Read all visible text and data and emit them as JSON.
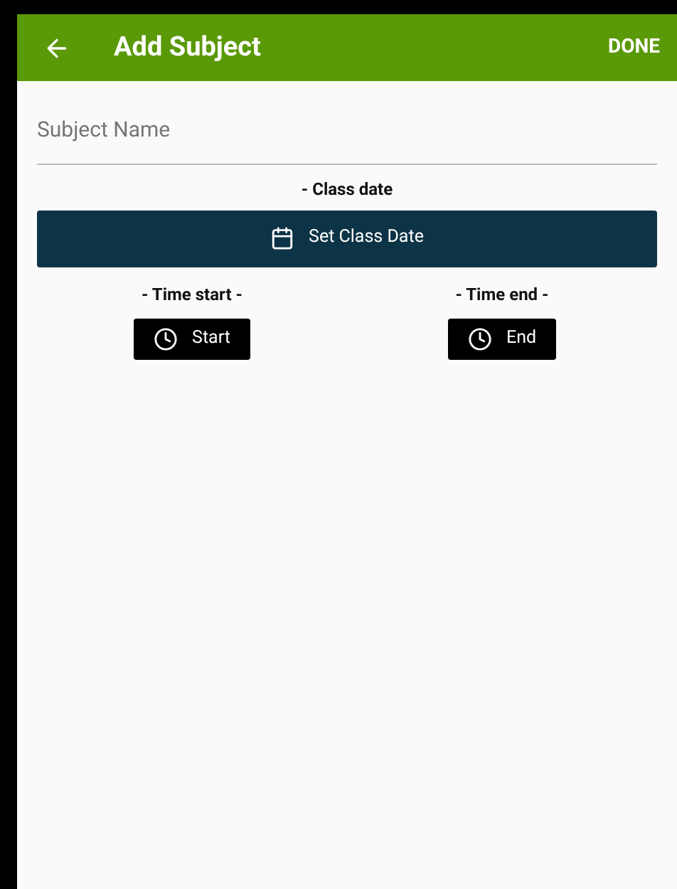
{
  "app_bar": {
    "title": "Add Subject",
    "action": "DONE"
  },
  "subject_field": {
    "placeholder": "Subject Name"
  },
  "class_date": {
    "label": "- Class date",
    "button": "Set Class Date"
  },
  "times": [
    {
      "label": "- Time start -",
      "button": "Start"
    },
    {
      "label": "- Time end -",
      "button": "End"
    }
  ]
}
